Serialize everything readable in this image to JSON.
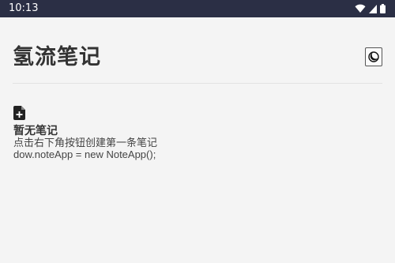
{
  "status_bar": {
    "time": "10:13",
    "icons": [
      "wifi-icon",
      "signal-icon",
      "battery-icon"
    ]
  },
  "header": {
    "title": "氢流笔记",
    "theme_toggle_icon": "moon-icon"
  },
  "empty_state": {
    "icon": "note-add-icon",
    "title": "暂无笔记",
    "hint": "点击右下角按钮创建第一条笔记",
    "code_line": "dow.noteApp = new NoteApp();"
  },
  "colors": {
    "status_bar_bg": "#2b2f45",
    "page_bg": "#f4f4f4",
    "text_primary": "#333333"
  }
}
